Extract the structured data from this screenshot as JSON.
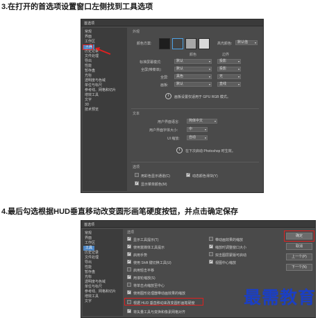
{
  "step1": "3.在打开的首选项设置窗口左侧找到工具选项",
  "step2": "4.最后勾选根据HUD垂直移动改变圆形画笔硬度按钮，并点击确定保存",
  "dialog1": {
    "title": "首选项",
    "sidebar": [
      "常规",
      "界面",
      "工作区",
      "工具",
      "历史记录",
      "文件处理",
      "导出",
      "性能",
      "暂存盘",
      "光标",
      "透明度与色域",
      "单位与标尺",
      "参考线、网格和切片",
      "增效工具",
      "文字",
      "3D",
      "技术预览"
    ],
    "active_index": 3,
    "appearance_group": "外观",
    "color_scheme_label": "颜色方案:",
    "highlight_label": "高光颜色:",
    "highlight_value": "默认值",
    "col_color": "颜色",
    "col_border": "边界",
    "rows": [
      {
        "label": "标准屏幕模式:",
        "color": "默认",
        "border": "投影"
      },
      {
        "label": "全屏(带菜单):",
        "color": "默认",
        "border": "投影"
      },
      {
        "label": "全屏:",
        "color": "黑色",
        "border": "无"
      },
      {
        "label": "画板:",
        "color": "默认",
        "border": "直线"
      }
    ],
    "note1": "画板设置仅适用于 GPU RGB 模式。",
    "text_group": "文本",
    "ui_language_label": "用户界面语言:",
    "ui_language_value": "简体中文",
    "ui_font_label": "用户界面字体大小:",
    "ui_font_value": "中",
    "ui_scale_label": "UI 缩放:",
    "ui_scale_value": "自动",
    "note2": "在下次启动 Photoshop 时生效。",
    "options_group": "选项",
    "options": [
      {
        "label": "用彩色显示通道(C)",
        "checked": false
      },
      {
        "label": "动态颜色滑块(Y)",
        "checked": true
      },
      {
        "label": "显示菜单颜色(M)",
        "checked": true
      }
    ]
  },
  "dialog2": {
    "title": "首选项",
    "sidebar": [
      "常规",
      "界面",
      "工作区",
      "工具",
      "历史记录",
      "文件处理",
      "导出",
      "性能",
      "暂存盘",
      "光标",
      "透明度与色域",
      "单位与标尺",
      "参考线、网格和切片",
      "增效工具",
      "文字"
    ],
    "active_index": 3,
    "options_group": "选项",
    "left_options": [
      {
        "label": "显示工具提示(T)",
        "checked": true
      },
      {
        "label": "使用富媒体工具提示",
        "checked": true
      },
      {
        "label": "启用手势",
        "checked": true
      },
      {
        "label": "使用 Shift 键切换工具(U)",
        "checked": true
      },
      {
        "label": "启用轻击平移",
        "checked": false
      },
      {
        "label": "用滚轮缩放(S)",
        "checked": true
      },
      {
        "label": "将单击点缩放至中心",
        "checked": false
      },
      {
        "label": "使用图形处理器带动画效果的缩放",
        "checked": true
      },
      {
        "label": "根据 HUD 垂直移动来改变圆形画笔硬度",
        "checked": false
      },
      {
        "label": "将矢量工具与变换和像素网格对齐",
        "checked": true
      }
    ],
    "right_options": [
      {
        "label": "带动画效果的缩放",
        "checked": false
      },
      {
        "label": "缩放时调整窗口大小",
        "checked": true
      },
      {
        "label": "双击图层蒙版可启动",
        "checked": false
      },
      {
        "label": "视图中心缩放",
        "checked": true
      }
    ],
    "buttons": [
      "确定",
      "取消",
      "上一个(P)",
      "下一个(N)"
    ]
  },
  "watermark": "最需教育",
  "colors": {
    "highlight": "#e02020",
    "active_item": "#4f88c6",
    "watermark": "#1b3fc4",
    "swatches": [
      "#1e1e1e",
      "#424242",
      "#a8a8a8",
      "#d9d9d9"
    ]
  }
}
